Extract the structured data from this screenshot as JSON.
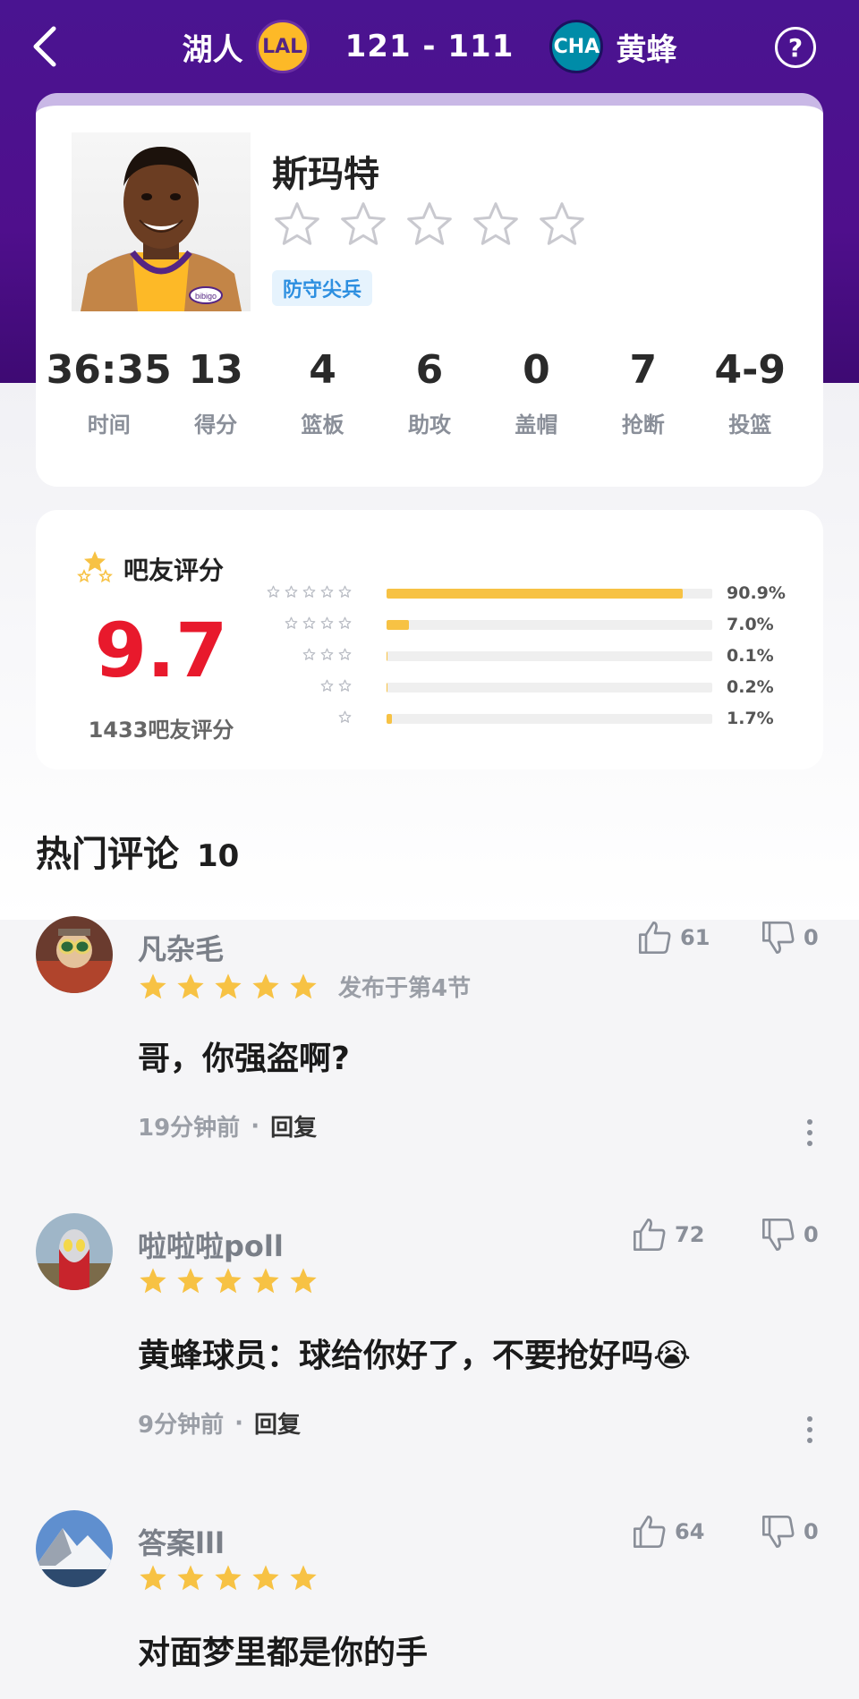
{
  "header": {
    "home_team": "湖人",
    "home_logo": "LAL",
    "score": "121 - 111",
    "away_logo": "CHA",
    "away_team": "黄蜂",
    "help_label": "?"
  },
  "player": {
    "name": "斯玛特",
    "rating_stars": 0,
    "tag": "防守尖兵",
    "jersey_text": "bibigo",
    "stats": [
      {
        "value": "36:35",
        "label": "时间"
      },
      {
        "value": "13",
        "label": "得分"
      },
      {
        "value": "4",
        "label": "篮板"
      },
      {
        "value": "6",
        "label": "助攻"
      },
      {
        "value": "0",
        "label": "盖帽"
      },
      {
        "value": "7",
        "label": "抢断"
      },
      {
        "value": "4-9",
        "label": "投篮"
      }
    ]
  },
  "rating": {
    "title": "吧友评分",
    "score": "9.7",
    "count_label": "1433吧友评分",
    "distribution": [
      {
        "stars": 5,
        "percent": 90.9,
        "label": "90.9%"
      },
      {
        "stars": 4,
        "percent": 7.0,
        "label": "7.0%"
      },
      {
        "stars": 3,
        "percent": 0.1,
        "label": "0.1%"
      },
      {
        "stars": 2,
        "percent": 0.2,
        "label": "0.2%"
      },
      {
        "stars": 1,
        "percent": 1.7,
        "label": "1.7%"
      }
    ]
  },
  "comments_section": {
    "title": "热门评论",
    "count": "10"
  },
  "comments": [
    {
      "user": "凡杂毛",
      "stars": 5,
      "posted": "发布于第4节",
      "text": "哥，你强盗啊?",
      "time": "19分钟前",
      "reply": "回复",
      "likes": "61",
      "dislikes": "0"
    },
    {
      "user": "啦啦啦poll",
      "stars": 5,
      "posted": "",
      "text": "黄蜂球员：球给你好了，不要抢好吗😭",
      "time": "9分钟前",
      "reply": "回复",
      "likes": "72",
      "dislikes": "0"
    },
    {
      "user": "答案lll",
      "stars": 5,
      "posted": "",
      "text": "对面梦里都是你的手",
      "time": "",
      "reply": "",
      "likes": "64",
      "dislikes": "0"
    }
  ],
  "colors": {
    "header_purple": "#4a1491",
    "score_red": "#e8192c",
    "star_yellow": "#f7c244",
    "tag_blue": "#2d8fe0"
  }
}
